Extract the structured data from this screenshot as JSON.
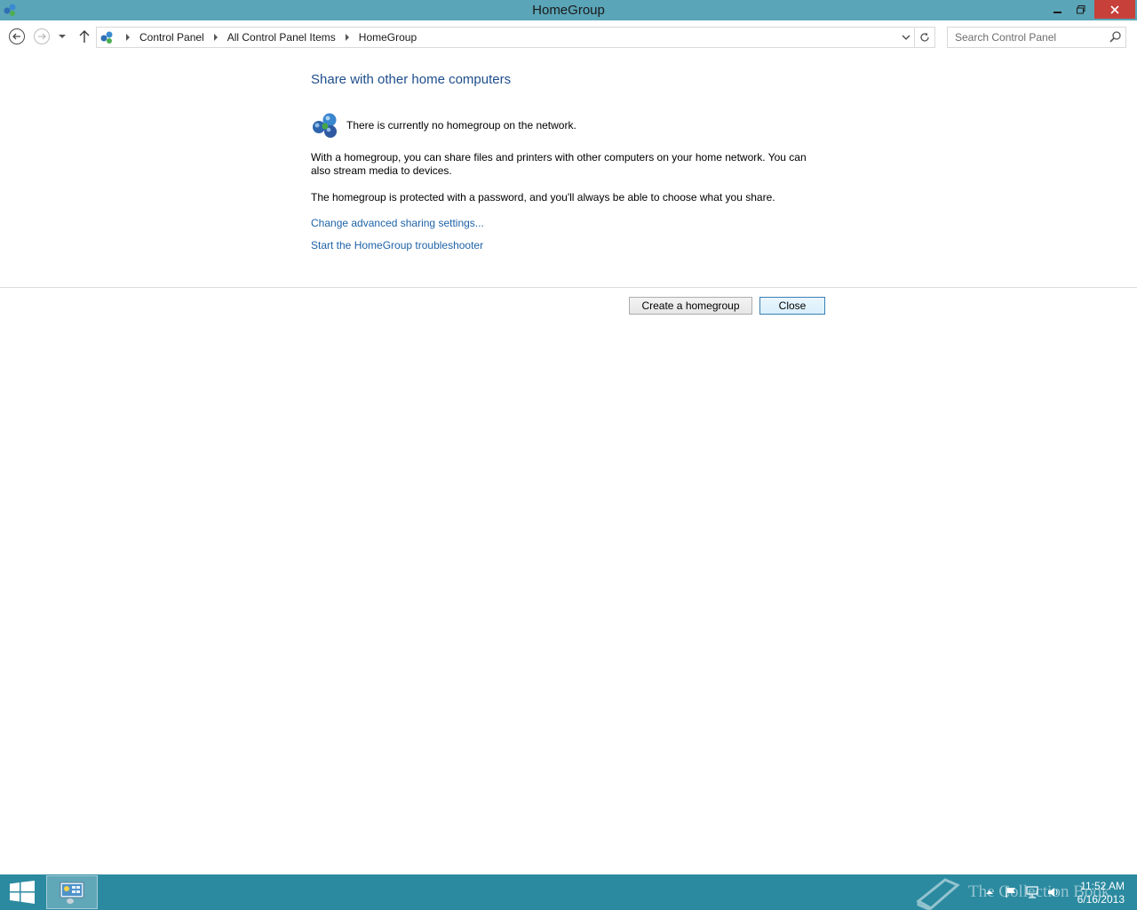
{
  "window": {
    "title": "HomeGroup"
  },
  "address": {
    "crumbs": [
      "Control Panel",
      "All Control Panel Items",
      "HomeGroup"
    ]
  },
  "search": {
    "placeholder": "Search Control Panel"
  },
  "content": {
    "heading": "Share with other home computers",
    "status": "There is currently no homegroup on the network.",
    "para1": "With a homegroup, you can share files and printers with other computers on your home network. You can also stream media to devices.",
    "para2": "The homegroup is protected with a password, and you'll always be able to choose what you share.",
    "link_advanced": "Change advanced sharing settings...",
    "link_troubleshooter": "Start the HomeGroup troubleshooter"
  },
  "buttons": {
    "create": "Create a homegroup",
    "close": "Close"
  },
  "taskbar": {
    "watermark": "The Collection Book",
    "time": "11:52 AM",
    "date": "6/16/2013"
  },
  "colors": {
    "titlebar": "#5aa5b8",
    "taskbar": "#2b8aa0",
    "heading": "#1e4e8c",
    "link": "#1e63a8",
    "close_button": "#c7403a"
  },
  "icons": {
    "app": "homegroup-icon",
    "back": "back-arrow-icon",
    "forward": "forward-arrow-icon",
    "recent": "chevron-down-icon",
    "up": "up-arrow-icon",
    "refresh": "refresh-icon",
    "search": "search-icon",
    "start": "windows-logo-icon"
  }
}
